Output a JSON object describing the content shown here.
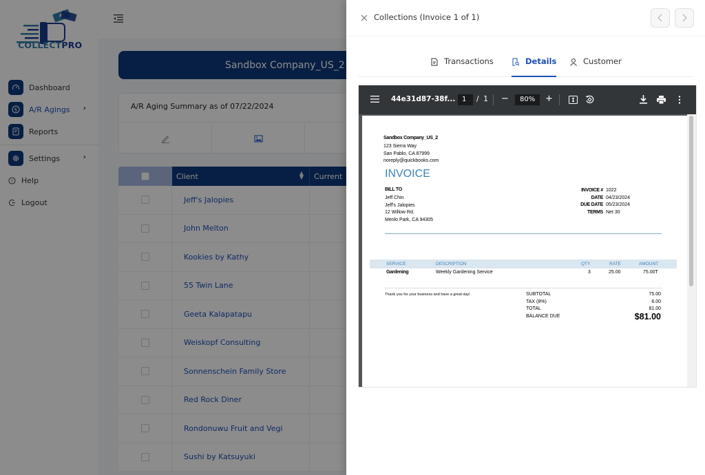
{
  "brand": {
    "name_part1": "COLLECT",
    "name_part2": "PRO"
  },
  "sidebar": {
    "items": [
      {
        "label": "Dashboard",
        "icon": "gauge-icon",
        "active": false,
        "has_chevron": false
      },
      {
        "label": "A/R Agings",
        "icon": "dollar-icon",
        "active": true,
        "has_chevron": true
      },
      {
        "label": "Reports",
        "icon": "report-icon",
        "active": false,
        "has_chevron": false
      },
      {
        "label": "Settings",
        "icon": "gear-icon",
        "active": false,
        "has_chevron": true
      }
    ],
    "plain_items": [
      {
        "label": "Help",
        "icon": "help-circle-icon"
      },
      {
        "label": "Logout",
        "icon": "logout-icon"
      }
    ],
    "chevron": "›"
  },
  "main": {
    "company_banner": "Sandbox Company_US_2",
    "summary_title": "A/R Aging Summary as of 07/22/2024",
    "table": {
      "columns": [
        "Client",
        "Current"
      ],
      "rows": [
        "Jeff's Jalopies",
        "John Melton",
        "Kookies by Kathy",
        "55 Twin Lane",
        "Geeta Kalapatapu",
        "Weiskopf Consulting",
        "Sonnenschein Family Store",
        "Red Rock Diner",
        "Rondonuwu Fruit and Vegi",
        "Sushi by Katsuyuki"
      ]
    }
  },
  "drawer": {
    "title": "Collections (Invoice 1 of 1)",
    "tabs": [
      {
        "label": "Transactions",
        "icon": "document-icon",
        "active": false
      },
      {
        "label": "Details",
        "icon": "document-search-icon",
        "active": true
      },
      {
        "label": "Customer",
        "icon": "user-icon",
        "active": false
      }
    ],
    "pdf": {
      "file_name": "44e31d87-38f...",
      "current_page": "1",
      "page_separator": "/",
      "total_pages": "1",
      "zoom": "80%",
      "minus": "−",
      "plus": "+"
    },
    "invoice": {
      "company": "Sandbox Company_US_2",
      "address_lines": [
        "123 Sierra Way",
        "San Pablo, CA  87999",
        "noreply@quickbooks.com"
      ],
      "title": "INVOICE",
      "bill_to_label": "BILL TO",
      "bill_to_lines": [
        "Jeff Chin",
        "Jeff's Jalopies",
        "12 Willow Rd.",
        "Menlo Park, CA  94305"
      ],
      "meta": [
        {
          "key": "INVOICE #",
          "value": "1022"
        },
        {
          "key": "DATE",
          "value": "04/23/2024"
        },
        {
          "key": "DUE DATE",
          "value": "05/23/2024"
        },
        {
          "key": "TERMS",
          "value": "Net 30"
        }
      ],
      "line_headers": {
        "service": "SERVICE",
        "description": "DESCRIPTION",
        "qty": "QTY",
        "rate": "RATE",
        "amount": "AMOUNT"
      },
      "lines": [
        {
          "service": "Gardening",
          "description": "Weekly Gardening Service",
          "qty": "3",
          "rate": "25.00",
          "amount": "75.00T"
        }
      ],
      "thanks": "Thank you for your business and have a great day!",
      "totals": [
        {
          "key": "SUBTOTAL",
          "value": "75.00"
        },
        {
          "key": "TAX (8%)",
          "value": "6.00"
        },
        {
          "key": "TOTAL",
          "value": "81.00"
        }
      ],
      "balance_due_label": "BALANCE DUE",
      "balance_due": "$81.00"
    }
  },
  "colors": {
    "brand_navy": "#0d3a7d",
    "link_blue": "#1a4fb5",
    "invoice_blue": "#3d82b8"
  }
}
